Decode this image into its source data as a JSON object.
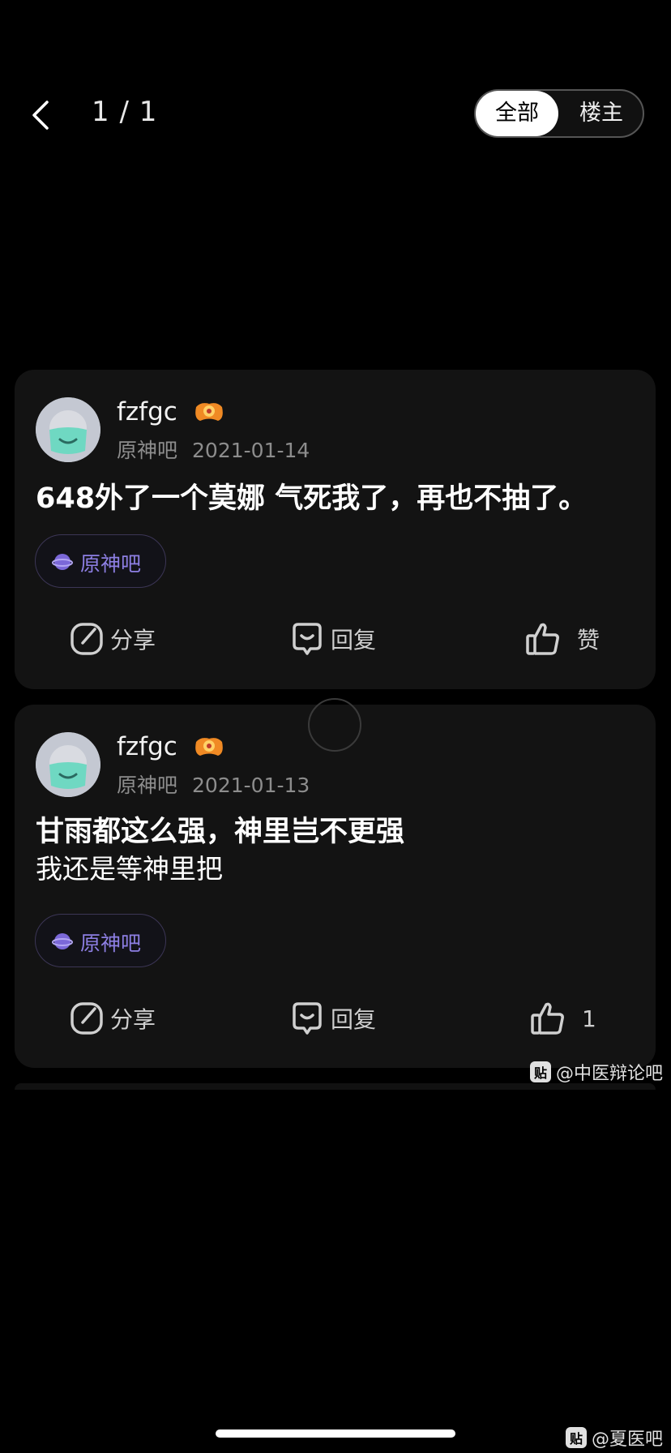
{
  "header": {
    "page_indicator": "1 / 1",
    "segment": {
      "all": "全部",
      "op": "楼主",
      "selected": "all"
    }
  },
  "posts": [
    {
      "username": "fzfgc",
      "forum": "原神吧",
      "date": "2021-01-14",
      "lines": [
        "648外了一个莫娜 气死我了，再也不抽了。"
      ],
      "forum_tag": "原神吧",
      "actions": {
        "share": "分享",
        "reply": "回复",
        "like": "赞"
      }
    },
    {
      "username": "fzfgc",
      "forum": "原神吧",
      "date": "2021-01-13",
      "lines": [
        "甘雨都这么强，神里岂不更强",
        "我还是等神里把"
      ],
      "forum_tag": "原神吧",
      "actions": {
        "share": "分享",
        "reply": "回复",
        "like": "1"
      }
    }
  ],
  "watermarks": {
    "first": {
      "icon": "贴",
      "text": "@中医辩论吧"
    },
    "second": {
      "icon": "贴",
      "text": "@夏医吧"
    }
  },
  "colors": {
    "background": "#000000",
    "card": "#131313",
    "forum_accent": "#8d7fe3",
    "badge_orange": "#f08a24"
  }
}
